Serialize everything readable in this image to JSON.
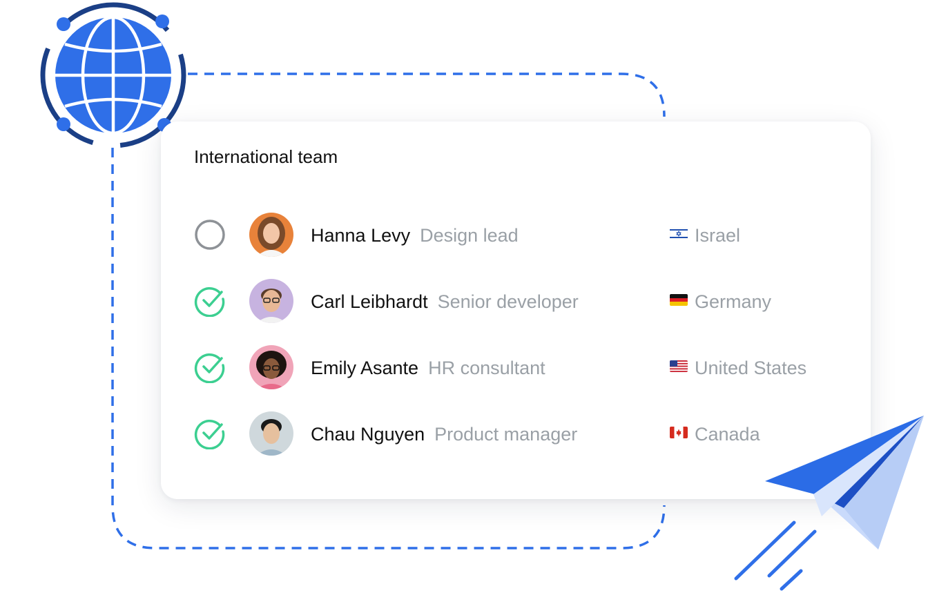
{
  "card": {
    "title": "International team"
  },
  "team": [
    {
      "name": "Hanna Levy",
      "role": "Design lead",
      "country": "Israel",
      "flag": "israel-flag",
      "status": "unchecked"
    },
    {
      "name": "Carl Leibhardt",
      "role": "Senior developer",
      "country": "Germany",
      "flag": "germany-flag",
      "status": "checked"
    },
    {
      "name": "Emily Asante",
      "role": "HR consultant",
      "country": "United States",
      "flag": "us-flag",
      "status": "checked"
    },
    {
      "name": "Chau Nguyen",
      "role": "Product manager",
      "country": "Canada",
      "flag": "canada-flag",
      "status": "checked"
    }
  ],
  "colors": {
    "accent_blue": "#2f6fe8",
    "dark_blue": "#1b3f86",
    "check_green": "#3ccf91",
    "unchecked_gray": "#8e9297",
    "muted_text": "#9aa0a6"
  },
  "icons": [
    "globe-icon",
    "paper-plane-icon",
    "checkmark-circle-icon",
    "empty-circle-icon"
  ]
}
